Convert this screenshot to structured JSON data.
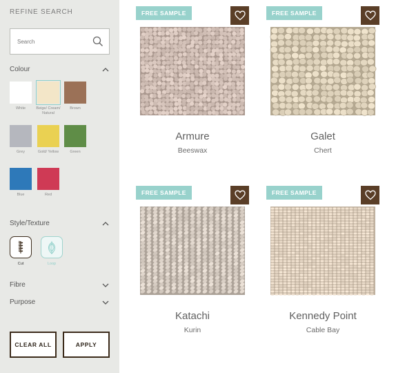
{
  "sidebar": {
    "title": "REFINE SEARCH",
    "search": {
      "placeholder": "Search",
      "value": ""
    },
    "colour": {
      "heading": "Colour",
      "swatches": [
        {
          "label": "White",
          "color": "#ffffff",
          "selected": false
        },
        {
          "label": "Beige/ Cream/ Natural",
          "color": "#f3e6c8",
          "selected": true
        },
        {
          "label": "Brown",
          "color": "#9b7157",
          "selected": false
        },
        {
          "label": "Grey",
          "color": "#b5b7be",
          "selected": false
        },
        {
          "label": "Gold/ Yellow",
          "color": "#ead152",
          "selected": false
        },
        {
          "label": "Green",
          "color": "#5f8d47",
          "selected": false
        },
        {
          "label": "Blue",
          "color": "#2e79b9",
          "selected": false
        },
        {
          "label": "Red",
          "color": "#cf3a55",
          "selected": false
        }
      ]
    },
    "style": {
      "heading": "Style/Texture",
      "options": [
        {
          "label": "Cut",
          "icon": "cut-pile-icon",
          "active": true
        },
        {
          "label": "Loop",
          "icon": "loop-pile-icon",
          "active": false
        }
      ]
    },
    "fibre": {
      "heading": "Fibre"
    },
    "purpose": {
      "heading": "Purpose"
    },
    "clear_label": "CLEAR ALL",
    "apply_label": "APPLY"
  },
  "products": [
    {
      "name": "Armure",
      "colour": "Beeswax",
      "badge": "FREE SAMPLE",
      "texture": "boucle",
      "tone": "#cdbbb2"
    },
    {
      "name": "Galet",
      "colour": "Chert",
      "badge": "FREE SAMPLE",
      "texture": "pebble",
      "tone": "#d8ccb5"
    },
    {
      "name": "Katachi",
      "colour": "Kurin",
      "badge": "FREE SAMPLE",
      "texture": "rib",
      "tone": "#cfc5bb"
    },
    {
      "name": "Kennedy Point",
      "colour": "Cable Bay",
      "badge": "FREE SAMPLE",
      "texture": "weave",
      "tone": "#e3d4c2"
    }
  ],
  "colors": {
    "accent_teal": "#98d2cc",
    "brand_brown": "#5a3e27",
    "sidebar_bg": "#e8e9e6"
  }
}
